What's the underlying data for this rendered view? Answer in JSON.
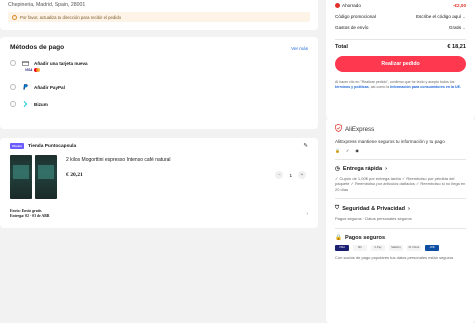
{
  "address": {
    "line": "Chepineria, Madrid, Spain, 28001",
    "notice": "Por favor, actualiza tu dirección para recibir el pedido"
  },
  "payment": {
    "title": "Métodos de pago",
    "see_more": "Ver más",
    "methods": [
      {
        "label": "Añadir una tarjeta nueva"
      },
      {
        "label": "Añadir PayPal"
      },
      {
        "label": "Bizum"
      }
    ],
    "card_brand": "VISA"
  },
  "store": {
    "badge": "Choice",
    "name": "Tienda Puntocapsula",
    "product_name": "2 kilos Mogorttini espresso Intenso café natural",
    "price": "€ 20,21",
    "quantity": "1",
    "shipping_line1": "Envío: Envío gratis",
    "shipping_line2": "Entrega: 02 - 03 de ABR"
  },
  "summary": {
    "savings_label": "Ahorrado",
    "savings_value": "-€2,00",
    "promo_label": "Código promocional",
    "promo_value": "Escribe el código aquí",
    "shipping_label": "Gastos de envío",
    "shipping_value": "Gratis",
    "total_label": "Total",
    "total_value": "€ 18,21",
    "order_button": "Realizar pedido",
    "legal_prefix": "Al hacer clic en \"Realizar pedido\", confirmo que he leído y acepto todos los",
    "legal_link1": "términos y políticas",
    "legal_mid": ", así como la",
    "legal_link2": "Información para consumidores en la UE."
  },
  "aliexpress": {
    "brand": "AliExpress",
    "desc": "AliExpress mantiene seguros tu información y tu pago",
    "fast_title": "Entrega rápida",
    "fast_body": "✓ Cupón de 1,00€ por entrega tardía ✓ Reembolso por pérdida del paquete ✓ Reembolso por artículos dañados ✓ Reembolso si no llega en 20 días",
    "security_title": "Seguridad & Privacidad",
    "security_body": "Pagos seguros · Datos personales seguros",
    "secure_pay_title": "Pagos seguros",
    "secure_pay_body": "Con socios de pago populares tus datos personales están seguros",
    "pay_logos": [
      "VISA",
      "MC",
      "G Pay",
      "SafeKey",
      "ID Check",
      "JCB"
    ]
  },
  "colors": {
    "accent": "#fd384f",
    "link": "#1f67d6",
    "choice": "#6b5cff"
  }
}
